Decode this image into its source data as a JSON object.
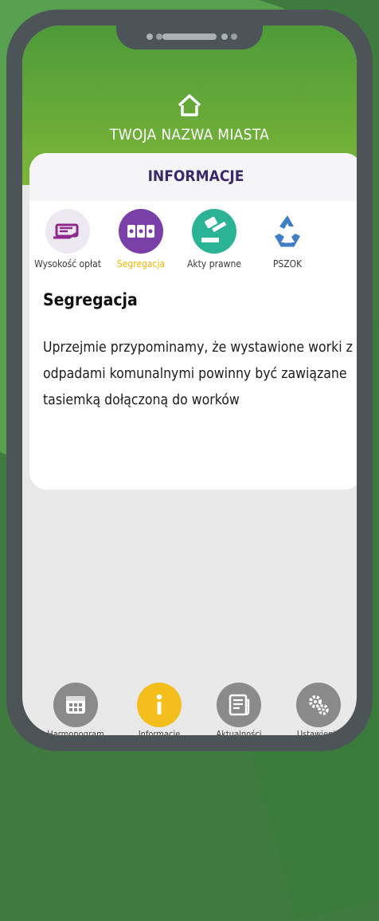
{
  "header": {
    "city_name": "TWOJA NAZWA MIASTA",
    "icon": "home-icon"
  },
  "card": {
    "title": "INFORMACJE",
    "tabs": [
      {
        "label": "Wysokość opłat",
        "icon": "hand-money-icon",
        "color": "#e9e3ef"
      },
      {
        "label": "Segregacja",
        "icon": "bins-icon",
        "color": "#7b3fa8",
        "active": true
      },
      {
        "label": "Akty prawne",
        "icon": "gavel-icon",
        "color": "#2ab395"
      },
      {
        "label": "PSZOK",
        "icon": "recycle-icon",
        "color": "#3e7fc3"
      }
    ],
    "section_title": "Segregacja",
    "body": "Uprzejmie przypominamy, że wystawione worki z odpadami komunalnymi powinny być zawiązane tasiemką dołączoną do worków"
  },
  "bottom_nav": [
    {
      "label": "Harmonogram",
      "icon": "calendar-icon"
    },
    {
      "label": "Informacje",
      "icon": "info-icon",
      "active": true
    },
    {
      "label": "Aktualności",
      "icon": "news-icon"
    },
    {
      "label": "Ustawienia",
      "icon": "gears-icon"
    }
  ],
  "colors": {
    "accent": "#f4be1c",
    "header_green": "#6eae39",
    "title_purple": "#3b2a6a"
  }
}
